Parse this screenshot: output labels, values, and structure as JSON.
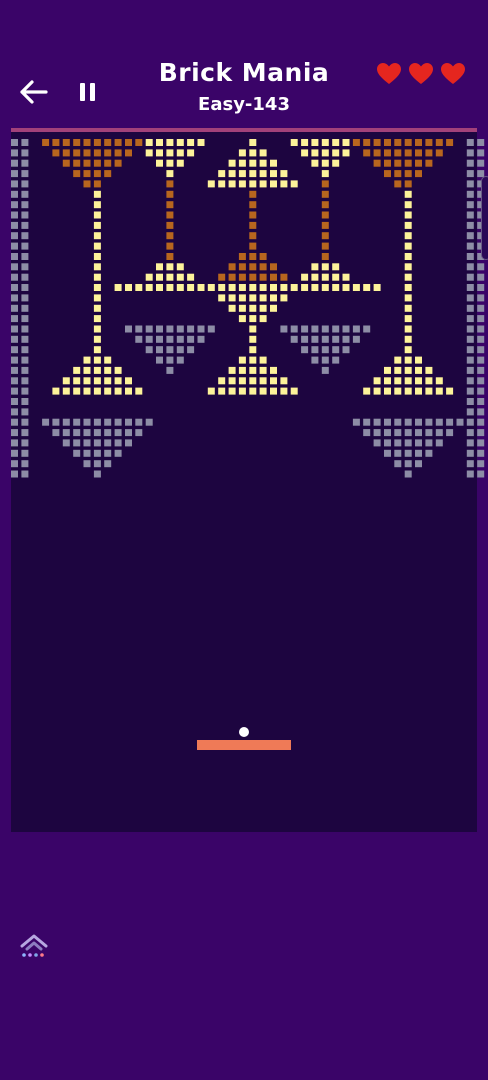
{
  "header": {
    "title": "Brick Mania",
    "level": "Easy-143",
    "lives": 3
  },
  "icons": {
    "back": "back-arrow-icon",
    "pause": "pause-icon",
    "life": "heart-icon",
    "dock": "game-app-icon"
  },
  "colors": {
    "background": "#3a0468",
    "playfield": "#1d0540",
    "divider": "#a2417a",
    "brick_yellow": "#fdf39a",
    "brick_orange": "#b8661e",
    "brick_gray": "#8d8da6",
    "paddle": "#ef7a57",
    "ball": "#ffffff",
    "heart": "#e5261f"
  }
}
